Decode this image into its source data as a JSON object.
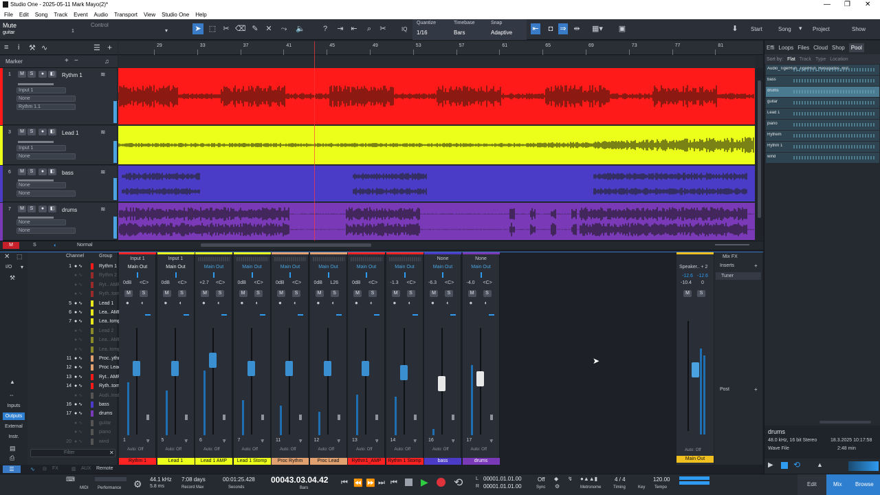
{
  "window": {
    "title": "Studio One - 2025-05-11 Mark Mayo(2)*",
    "controls": [
      "—",
      "❐",
      "✕"
    ]
  },
  "menu": [
    "File",
    "Edit",
    "Song",
    "Track",
    "Event",
    "Audio",
    "Transport",
    "View",
    "Studio One",
    "Help"
  ],
  "toolbar": {
    "mute_label": "Mute",
    "control_label": "Control",
    "track_name": "guitar",
    "channel_num": "1",
    "quantize_label": "Quantize",
    "quantize_value": "1/16",
    "timebase_label": "Timebase",
    "timebase_value": "Bars",
    "snap_label": "Snap",
    "snap_value": "Adaptive",
    "iq": "IQ",
    "nav": {
      "start": "Start",
      "song": "Song",
      "project": "Project",
      "show": "Show"
    }
  },
  "arrange": {
    "marker_label": "Marker",
    "ruler": [
      "29",
      "33",
      "37",
      "41",
      "45",
      "49",
      "53",
      "57",
      "61",
      "65",
      "69",
      "73",
      "77",
      "81"
    ],
    "tracks": [
      {
        "num": "1",
        "name": "Rythm 1",
        "input": "Input 1",
        "out": "None",
        "sub": "Rythm 1.1",
        "color": "#ff1a1a",
        "wave": "#5a1a10"
      },
      {
        "num": "3",
        "name": "Lead 1",
        "input": "Input 1",
        "out": "None",
        "sub": "",
        "color": "#ecff1a",
        "wave": "#4a4d14"
      },
      {
        "num": "6",
        "name": "bass",
        "input": "None",
        "out": "None",
        "sub": "",
        "color": "#4a3cc7",
        "wave": "#2a2a3a"
      },
      {
        "num": "7",
        "name": "drums",
        "input": "None",
        "out": "None",
        "sub": "",
        "color": "#7a3ab8",
        "wave": "#2a1f36"
      }
    ],
    "footer": {
      "m": "M",
      "s": "S",
      "mode": "Normal"
    }
  },
  "browser": {
    "tabs": [
      "Effi",
      "Loops",
      "Files",
      "Cloud",
      "Shop",
      "Pool"
    ],
    "sort_label": "Sort by:",
    "sort_opts": [
      "Flat",
      "Track",
      "Type",
      "Location"
    ],
    "items": [
      "Audio_TigerRun_TigerRun_Renagades_Inst",
      "bass",
      "drums",
      "guitar",
      "Lead 1",
      "piano",
      "Rythem",
      "Rythm 1",
      "wind"
    ],
    "selected": {
      "name": "drums",
      "format": "48.0 kHz, 16 bit Stereo",
      "date": "18.3.2025 10:17:58",
      "type": "Wave File",
      "duration": "2:48 min"
    }
  },
  "console": {
    "header": {
      "channel": "Channel",
      "group": "Group",
      "io": "I/O"
    },
    "side": [
      "Inputs",
      "Outputs",
      "External",
      "Instr."
    ],
    "filter_placeholder": "Filter",
    "list": [
      {
        "n": "1",
        "name": "Rythm 1",
        "c": "#ff1a1a",
        "dim": false
      },
      {
        "n": "",
        "name": "Rythm 2",
        "c": "#9a2a2a",
        "dim": true
      },
      {
        "n": "",
        "name": "Ryt.. AMP",
        "c": "#9a2a2a",
        "dim": true
      },
      {
        "n": "",
        "name": "Ryth..tomp",
        "c": "#9a2a2a",
        "dim": true
      },
      {
        "n": "5",
        "name": "Lead 1",
        "c": "#e8e81a",
        "dim": false
      },
      {
        "n": "6",
        "name": "Lea.. AMP",
        "c": "#e8e81a",
        "dim": false
      },
      {
        "n": "7",
        "name": "Lea..tomp",
        "c": "#e8e81a",
        "dim": false
      },
      {
        "n": "",
        "name": "Lead 2",
        "c": "#8a8a2a",
        "dim": true
      },
      {
        "n": "",
        "name": "Lea.. AMP",
        "c": "#8a8a2a",
        "dim": true
      },
      {
        "n": "",
        "name": "Lea..tomp",
        "c": "#8a8a2a",
        "dim": true
      },
      {
        "n": "11",
        "name": "Proc..ythm",
        "c": "#e0a070",
        "dim": false
      },
      {
        "n": "12",
        "name": "Proc Lead",
        "c": "#e0a070",
        "dim": false
      },
      {
        "n": "13",
        "name": "Ryt.. AMP",
        "c": "#ff1a1a",
        "dim": false
      },
      {
        "n": "14",
        "name": "Ryth..tomp",
        "c": "#ff1a1a",
        "dim": false
      },
      {
        "n": "",
        "name": "Audi..Inst",
        "c": "#555",
        "dim": true
      },
      {
        "n": "16",
        "name": "bass",
        "c": "#4a3cc7",
        "dim": false
      },
      {
        "n": "17",
        "name": "drums",
        "c": "#7a3ab8",
        "dim": false
      },
      {
        "n": "",
        "name": "guitar",
        "c": "#555",
        "dim": true
      },
      {
        "n": "",
        "name": "piano",
        "c": "#555",
        "dim": true
      },
      {
        "n": "20",
        "name": "wind",
        "c": "#555",
        "dim": true
      }
    ],
    "channels": [
      {
        "num": "1",
        "in": "Input 1",
        "out": "Main Out",
        "db": "0dB",
        "pan": "<C>",
        "name": "Rythm 1",
        "color": "#ff2222",
        "fader": 0.62,
        "meter": 0.45
      },
      {
        "num": "5",
        "in": "Input 1",
        "out": "Main Out",
        "db": "0dB",
        "pan": "<C>",
        "name": "Lead 1",
        "color": "#ecff1a",
        "fader": 0.62,
        "meter": 0.38
      },
      {
        "num": "6",
        "in": "",
        "out": "Main Out",
        "db": "+2.7",
        "pan": "<C>",
        "name": "Lead 1 AMP",
        "color": "#ecff1a",
        "fader": 0.7,
        "meter": 0.55
      },
      {
        "num": "7",
        "in": "",
        "out": "Main Out",
        "db": "0dB",
        "pan": "<C>",
        "name": "Lead 1 Stomp",
        "color": "#ecff1a",
        "fader": 0.62,
        "meter": 0.3
      },
      {
        "num": "11",
        "in": "",
        "out": "Main Out",
        "db": "0dB",
        "pan": "<C>",
        "name": "Proc Rythm",
        "color": "#e0a070",
        "fader": 0.62,
        "meter": 0.25
      },
      {
        "num": "12",
        "in": "",
        "out": "Main Out",
        "db": "0dB",
        "pan": "L26",
        "name": "Proc Lead",
        "color": "#e0a070",
        "fader": 0.62,
        "meter": 0.2
      },
      {
        "num": "13",
        "in": "",
        "out": "Main Out",
        "db": "0dB",
        "pan": "<C>",
        "name": "Rythm1_AMP",
        "color": "#ff2222",
        "fader": 0.62,
        "meter": 0.35
      },
      {
        "num": "14",
        "in": "",
        "out": "Main Out",
        "db": "-1.3",
        "pan": "<C>",
        "name": "Rythm 1 Stomp",
        "color": "#ff2222",
        "fader": 0.58,
        "meter": 0.33
      },
      {
        "num": "16",
        "in": "None",
        "out": "Main Out",
        "db": "-6.3",
        "pan": "<C>",
        "name": "bass",
        "color": "#4a3cc7",
        "fader": 0.48,
        "meter": 0.05
      },
      {
        "num": "17",
        "in": "None",
        "out": "Main Out",
        "db": "-4.0",
        "pan": "<C>",
        "name": "drums",
        "color": "#7a3ab8",
        "fader": 0.52,
        "meter": 0.6
      }
    ],
    "main": {
      "out": "Speaker.. + 2",
      "l": "-12.6",
      "r": "-12.6",
      "db": "-10.4",
      "pan": "0",
      "name": "Main Out",
      "color": "#f0c020",
      "mixfx": "Mix FX",
      "inserts": "Inserts",
      "tuner": "Tuner",
      "post": "Post"
    },
    "auto": "Auto: Off",
    "m": "M",
    "s": "S"
  },
  "transport": {
    "remote": "Remote",
    "midi": "MIDI",
    "performance": "Performance",
    "rate": "44.1 kHz",
    "latency": "5.8 ms",
    "record_max": "7:08 days",
    "record_max_label": "Record Max",
    "seconds": "00:01:25.428",
    "seconds_label": "Seconds",
    "bars": "00043.03.04.42",
    "bars_label": "Bars",
    "loop_l": "00001.01.01.00",
    "loop_r": "00001.01.01.00",
    "sync_val": "Off",
    "sync_label": "Sync",
    "metronome_label": "Metronome",
    "timing": "4 / 4",
    "timing_label": "Timing",
    "key_label": "Key",
    "tempo": "120.00",
    "tempo_label": "Tempo",
    "edit": "Edit",
    "mix": "Mix",
    "browse": "Browse"
  }
}
